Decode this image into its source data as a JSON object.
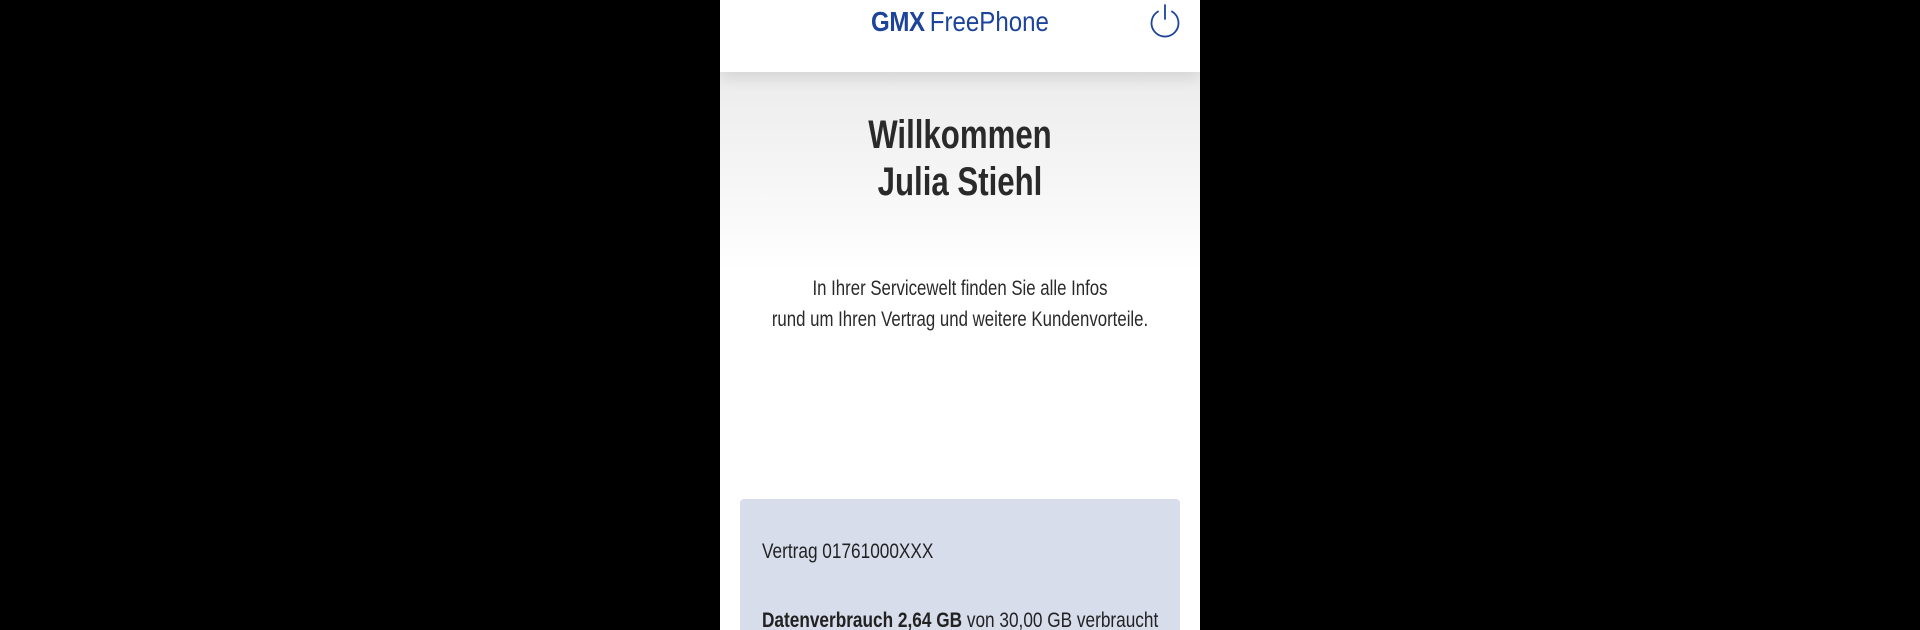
{
  "header": {
    "brand_strong": "GMX",
    "brand_product": "FreePhone",
    "brand_color": "#1c449b",
    "logout_icon": "power-icon"
  },
  "welcome": {
    "line1": "Willkommen",
    "line2": "Julia Stiehl"
  },
  "intro": {
    "line1": "In Ihrer Servicewelt finden Sie alle Infos",
    "line2": "rund um Ihren Vertrag und weitere Kundenvorteile."
  },
  "contract_card": {
    "background_color": "#d8ddec",
    "contract_label": "Vertrag 01761000XXX",
    "usage_label": "Datenverbrauch",
    "usage_amount": "2,64 GB",
    "usage_rest": "von 30,00 GB verbraucht"
  }
}
